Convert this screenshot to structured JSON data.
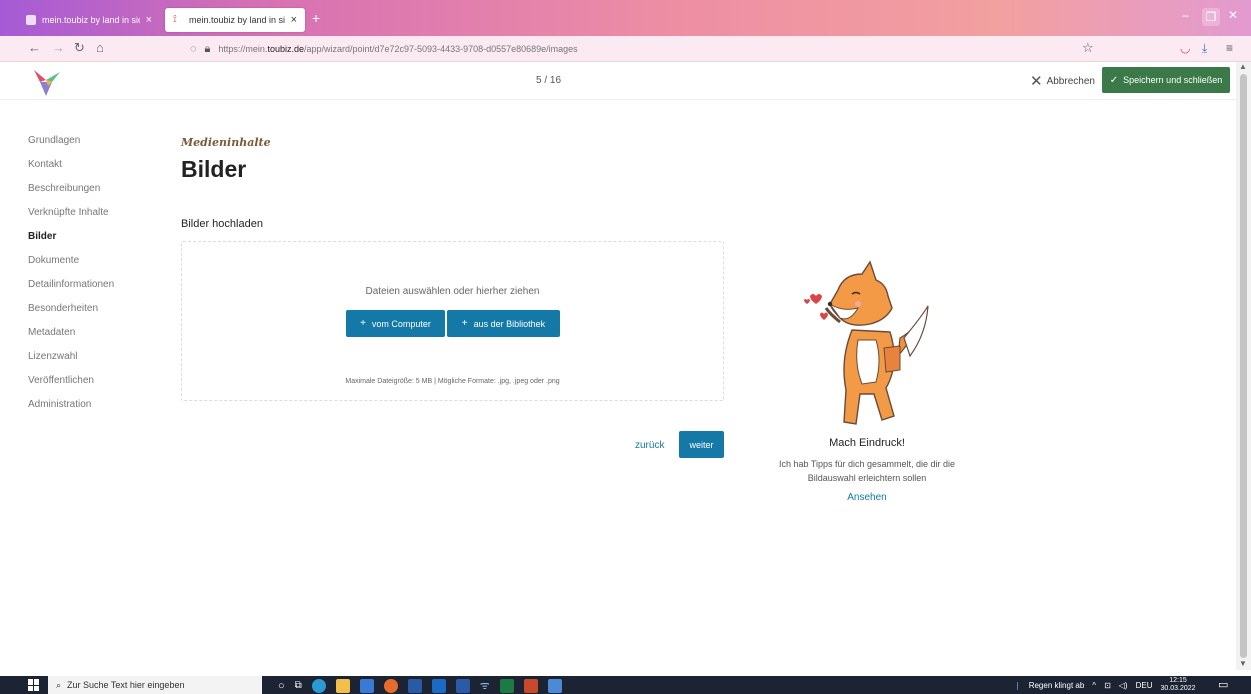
{
  "browser": {
    "tabs": [
      {
        "label": "mein.toubiz by land in sicht",
        "close": "×"
      },
      {
        "label": "mein.toubiz by land in sicht",
        "close": "×"
      }
    ],
    "new_tab": "+",
    "url_prefix": "https://mein.",
    "url_domain": "toubiz.de",
    "url_path": "/app/wizard/point/d7e72c97-5093-4433-9708-d0557e80689e/images"
  },
  "header": {
    "step": "5 / 16",
    "cancel_label": "Abbrechen",
    "save_label": "Speichern und schließen",
    "accent_color": "#3b7a48"
  },
  "sidebar": {
    "items": [
      {
        "label": "Grundlagen"
      },
      {
        "label": "Kontakt"
      },
      {
        "label": "Beschreibungen"
      },
      {
        "label": "Verknüpfte Inhalte"
      },
      {
        "label": "Bilder"
      },
      {
        "label": "Dokumente"
      },
      {
        "label": "Detailinformationen"
      },
      {
        "label": "Besonderheiten"
      },
      {
        "label": "Metadaten"
      },
      {
        "label": "Lizenzwahl"
      },
      {
        "label": "Veröffentlichen"
      },
      {
        "label": "Administration"
      }
    ],
    "active": "Bilder"
  },
  "main": {
    "kicker": "Medieninhalte",
    "title": "Bilder",
    "upload_label": "Bilder hochladen",
    "dropzone": {
      "hint": "Dateien auswählen oder hierher ziehen",
      "btn_computer": "vom Computer",
      "btn_library": "aus der Bibliothek",
      "limits": "Maximale Dateigröße: 5 MB | Mögliche Formate: .jpg, .jpeg oder .png"
    },
    "back_label": "zurück",
    "next_label": "weiter",
    "primary_color": "#1479a6"
  },
  "tips": {
    "title": "Mach Eindruck!",
    "text": "Ich hab Tipps für dich gesammelt, die dir die Bildauswahl erleichtern sollen",
    "link": "Ansehen"
  },
  "taskbar": {
    "search_placeholder": "Zur Suche Text hier eingeben",
    "weather": "Regen klingt ab",
    "lang": "DEU",
    "time": "12:15",
    "date": "30.03.2022"
  }
}
